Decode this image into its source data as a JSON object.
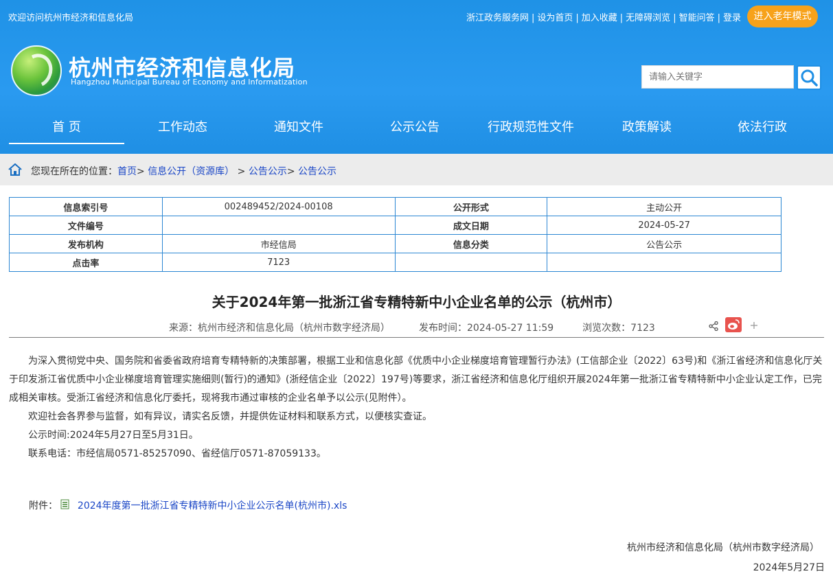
{
  "header": {
    "welcome": "欢迎访问杭州市经济和信息化局",
    "top_links": [
      "浙江政务服务网",
      "设为首页",
      "加入收藏",
      "无障碍浏览",
      "智能问答",
      "登录"
    ],
    "elder_mode": "进入老年模式",
    "site_title": "杭州市经济和信息化局",
    "site_subtitle": "Hangzhou Municipal Bureau of Economy and Informatization",
    "search_placeholder": "请输入关键字",
    "accent": "#1f8fe4",
    "elder_color": "#f7a21b"
  },
  "nav": [
    "首 页",
    "工作动态",
    "通知文件",
    "公示公告",
    "行政规范性文件",
    "政策解读",
    "依法行政"
  ],
  "breadcrumb": {
    "prefix": "您现在所在的位置：",
    "items": [
      "首页",
      "信息公开（资源库）",
      "公告公示",
      "公告公示"
    ]
  },
  "meta": {
    "rows": [
      [
        "信息索引号",
        "002489452/2024-00108",
        "公开形式",
        "主动公开"
      ],
      [
        "文件编号",
        "",
        "成文日期",
        "2024-05-27"
      ],
      [
        "发布机构",
        "市经信局",
        "信息分类",
        "公告公示"
      ],
      [
        "点击率",
        "7123",
        "",
        ""
      ]
    ]
  },
  "article": {
    "title": "关于2024年第一批浙江省专精特新中小企业名单的公示（杭州市）",
    "source": "来源：杭州市经济和信息化局（杭州市数字经济局）",
    "publish_time": "发布时间：2024-05-27 11:59",
    "views": "浏览次数：7123",
    "paragraphs": [
      "为深入贯彻党中央、国务院和省委省政府培育专精特新的决策部署，根据工业和信息化部《优质中小企业梯度培育管理暂行办法》(工信部企业〔2022〕63号)和《浙江省经济和信息化厅关于印发浙江省优质中小企业梯度培育管理实施细则(暂行)的通知》(浙经信企业〔2022〕197号)等要求，浙江省经济和信息化厅组织开展2024年第一批浙江省专精特新中小企业认定工作，已完成相关审核。受浙江省经济和信息化厅委托，现将我市通过审核的企业名单予以公示(见附件）。",
      "欢迎社会各界参与监督，如有异议，请实名反馈，并提供佐证材料和联系方式，以便核实查证。",
      "公示时间:2024年5月27日至5月31日。",
      "联系电话：市经信局0571-85257090、省经信厅0571-87059133。"
    ],
    "attachment_label": "附件：",
    "attachment_file": "2024年度第一批浙江省专精特新中小企业公示名单(杭州市).xls",
    "signature": "杭州市经济和信息化局（杭州市数字经济局）",
    "date": "2024年5月27日"
  }
}
